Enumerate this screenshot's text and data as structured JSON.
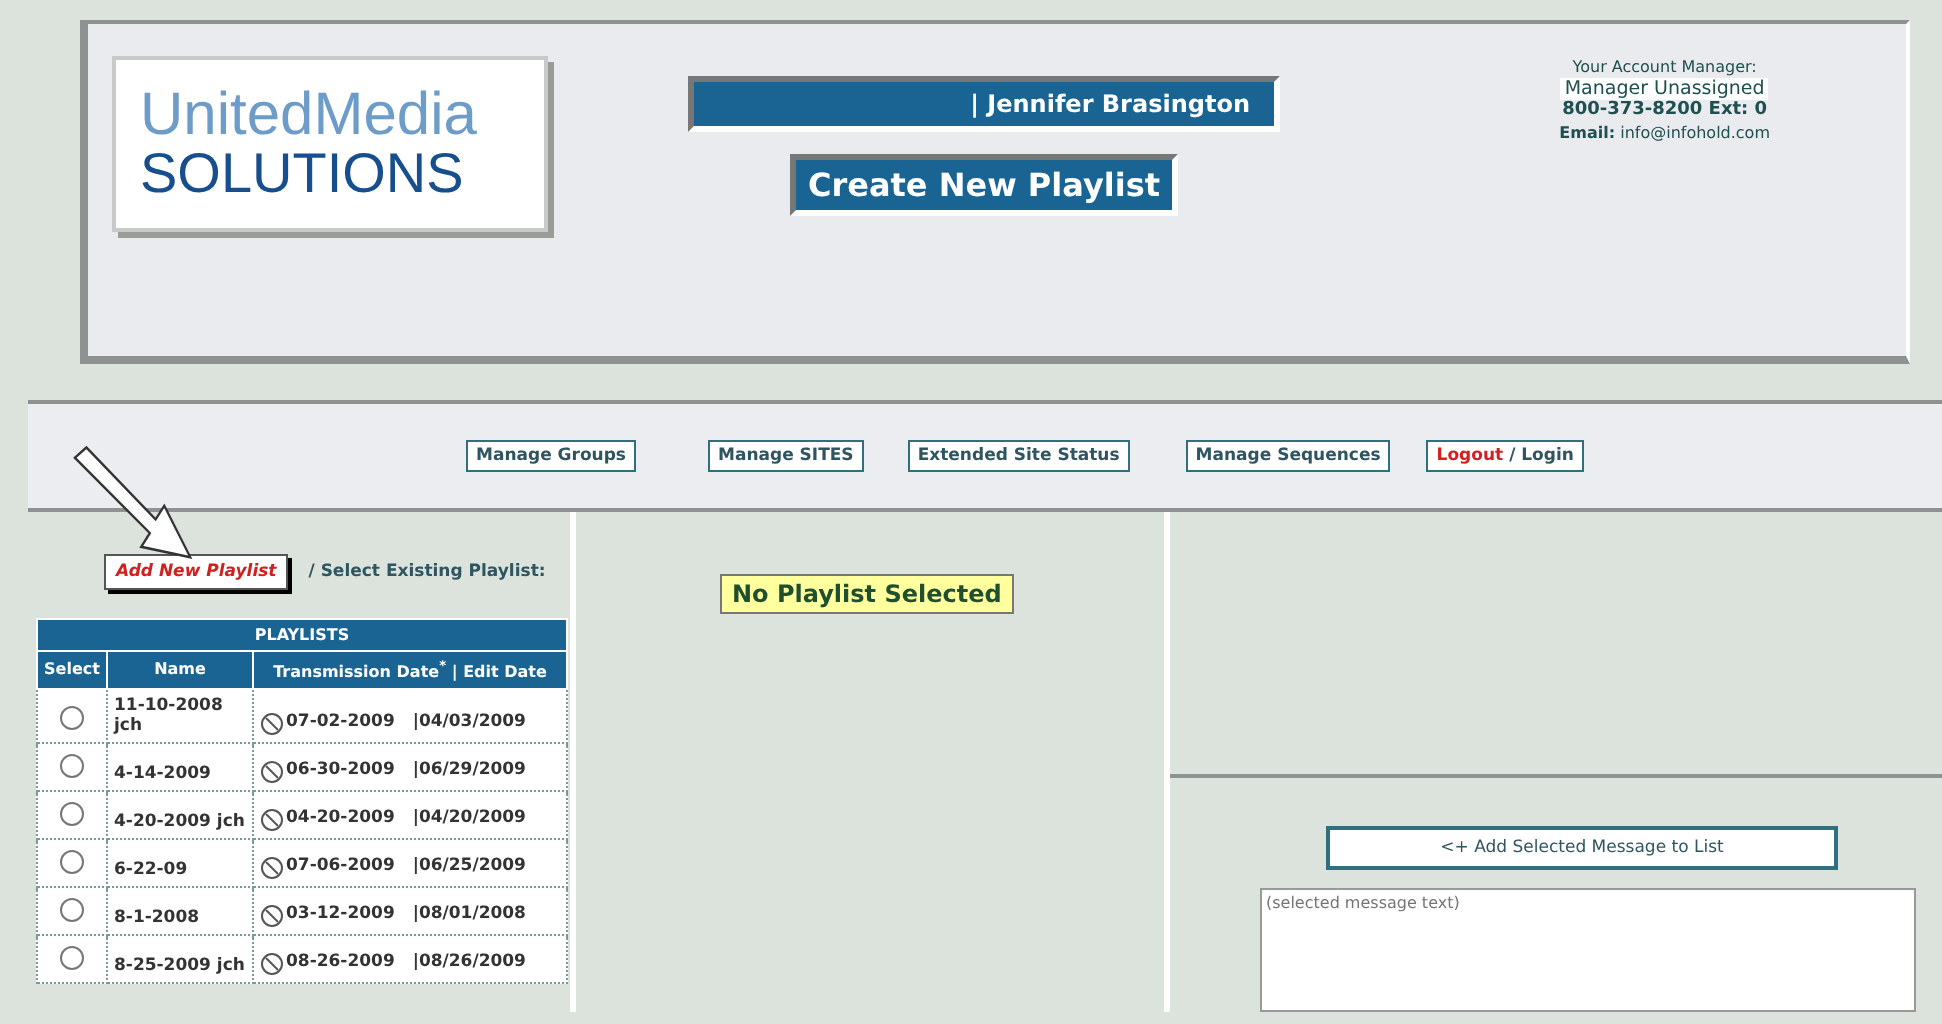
{
  "logo": {
    "line1": "UnitedMedia",
    "line2": "SOLUTIONS"
  },
  "user_bar": {
    "text": "| Jennifer Brasington"
  },
  "page_title": "Create New Playlist",
  "account": {
    "label": "Your Account Manager:",
    "manager": "Manager Unassigned",
    "phone": "800-373-8200 Ext: 0",
    "email_label": "Email:",
    "email": "info@infohold.com"
  },
  "nav": [
    {
      "label": "Manage Groups",
      "kind": "plain"
    },
    {
      "label": "Manage SITES",
      "kind": "plain"
    },
    {
      "label": "Extended Site Status",
      "kind": "plain"
    },
    {
      "label": "Manage Sequences",
      "kind": "plain"
    },
    {
      "label": "Logout",
      "second": "/ Login",
      "kind": "auth"
    }
  ],
  "add_playlist": "Add New Playlist",
  "select_existing": "/ Select Existing Playlist:",
  "playlists": {
    "title": "PLAYLISTS",
    "columns": [
      "Select",
      "Name",
      "Transmission Date",
      "*",
      "| Edit Date"
    ],
    "rows": [
      {
        "name": "11-10-2008 jch",
        "transmission": "07-02-2009",
        "edit": "|04/03/2009",
        "selected": false
      },
      {
        "name": "4-14-2009",
        "transmission": "06-30-2009",
        "edit": "|06/29/2009",
        "selected": false
      },
      {
        "name": "4-20-2009 jch",
        "transmission": "04-20-2009",
        "edit": "|04/20/2009",
        "selected": false
      },
      {
        "name": "6-22-09",
        "transmission": "07-06-2009",
        "edit": "|06/25/2009",
        "selected": false
      },
      {
        "name": "8-1-2008",
        "transmission": "03-12-2009",
        "edit": "|08/01/2008",
        "selected": false
      },
      {
        "name": "8-25-2009 jch",
        "transmission": "08-26-2009",
        "edit": "|08/26/2009",
        "selected": false
      }
    ]
  },
  "status": "No Playlist Selected",
  "add_message": "<+ Add Selected Message to List",
  "message_placeholder": "(selected message text)"
}
